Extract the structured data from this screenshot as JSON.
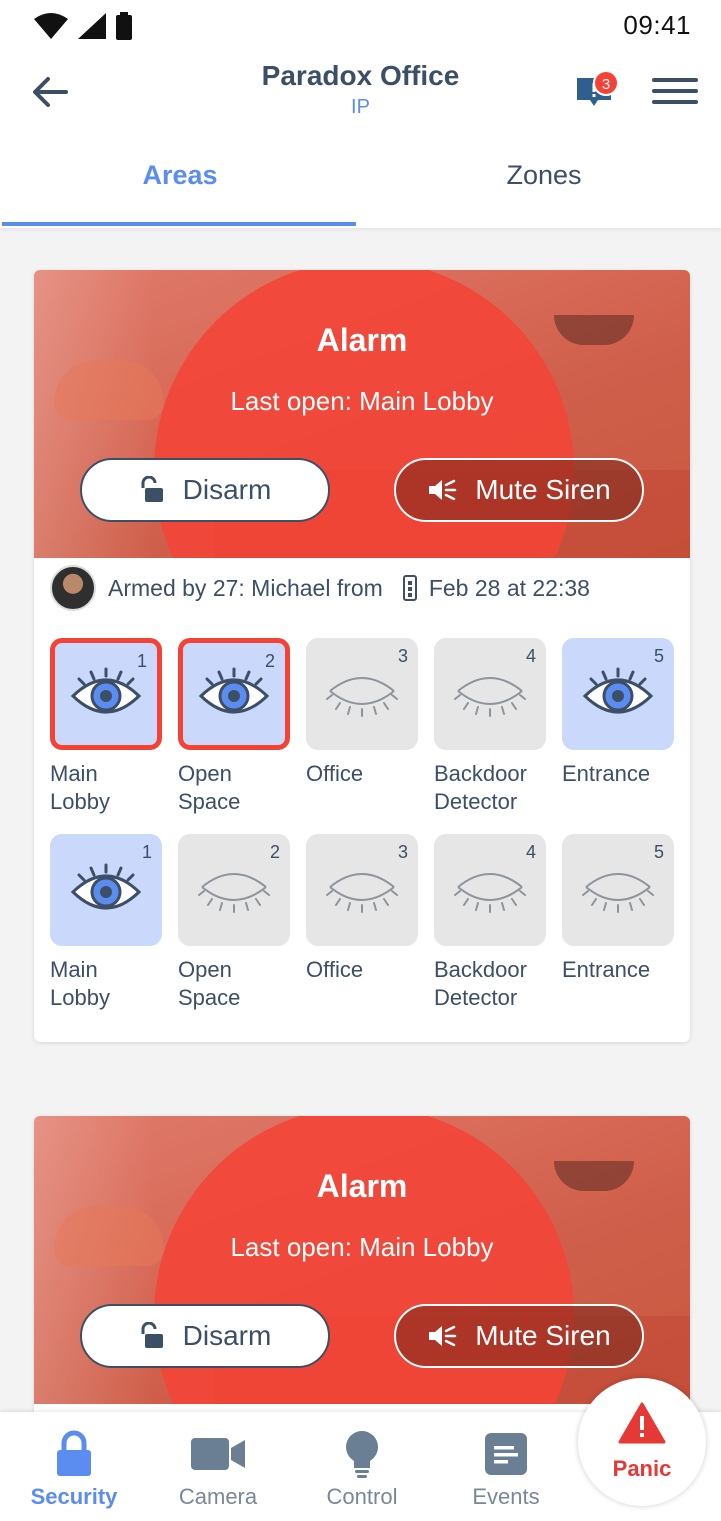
{
  "status_bar": {
    "time": "09:41"
  },
  "header": {
    "title": "Paradox Office",
    "subtitle": "IP",
    "notification_count": "3"
  },
  "tabs": [
    {
      "label": "Areas",
      "active": true
    },
    {
      "label": "Zones",
      "active": false
    }
  ],
  "cards": [
    {
      "alarm_title": "Alarm",
      "alarm_sub": "Last open: Main Lobby",
      "disarm_label": "Disarm",
      "mute_label": "Mute Siren",
      "armed_by": "Armed by 27: Michael from",
      "armed_time": "Feb 28 at 22:38",
      "zone_rows": [
        [
          {
            "num": "1",
            "line1": "Main",
            "line2": "Lobby",
            "state": "alarm"
          },
          {
            "num": "2",
            "line1": "Open",
            "line2": "Space",
            "state": "alarm"
          },
          {
            "num": "3",
            "line1": "Office",
            "line2": "",
            "state": "closed"
          },
          {
            "num": "4",
            "line1": "Backdoor",
            "line2": "Detector",
            "state": "closed"
          },
          {
            "num": "5",
            "line1": "Entrance",
            "line2": "",
            "state": "open"
          }
        ],
        [
          {
            "num": "1",
            "line1": "Main",
            "line2": "Lobby",
            "state": "open"
          },
          {
            "num": "2",
            "line1": "Open",
            "line2": "Space",
            "state": "closed"
          },
          {
            "num": "3",
            "line1": "Office",
            "line2": "",
            "state": "closed"
          },
          {
            "num": "4",
            "line1": "Backdoor",
            "line2": "Detector",
            "state": "closed"
          },
          {
            "num": "5",
            "line1": "Entrance",
            "line2": "",
            "state": "closed"
          }
        ]
      ]
    },
    {
      "alarm_title": "Alarm",
      "alarm_sub": "Last open: Main Lobby",
      "disarm_label": "Disarm",
      "mute_label": "Mute Siren"
    }
  ],
  "panic": {
    "label": "Panic"
  },
  "bottom_nav": [
    {
      "label": "Security",
      "icon": "lock-icon",
      "active": true
    },
    {
      "label": "Camera",
      "icon": "camera-icon",
      "active": false
    },
    {
      "label": "Control",
      "icon": "bulb-icon",
      "active": false
    },
    {
      "label": "Events",
      "icon": "events-icon",
      "active": false
    }
  ],
  "colors": {
    "accent": "#5b8df0",
    "alarm": "#f44336",
    "text": "#3d4f66",
    "zone_open": "#c9d8fb",
    "zone_closed": "#e6e6e6"
  }
}
